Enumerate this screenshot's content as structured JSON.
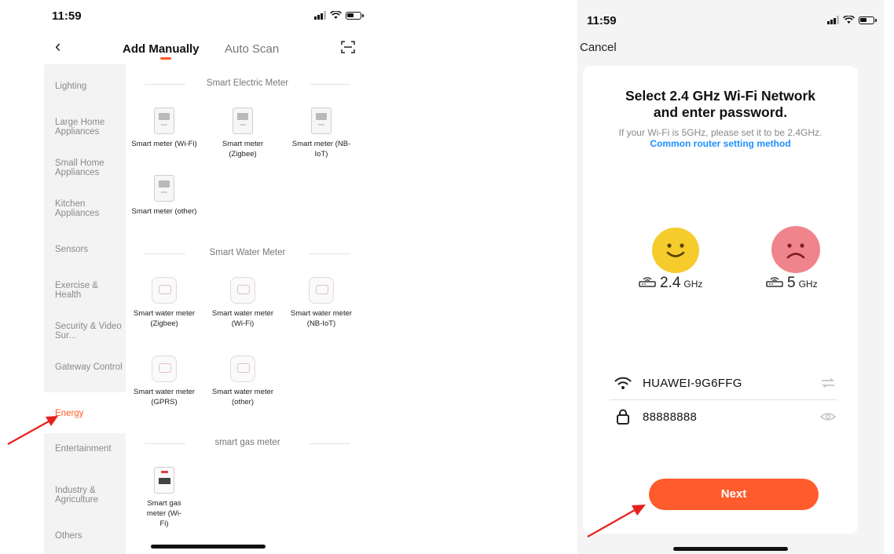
{
  "left_screen": {
    "status": {
      "time": "11:59"
    },
    "header": {
      "back_icon": "chevron-left-icon",
      "tab_manual": "Add Manually",
      "tab_auto": "Auto Scan",
      "scan_icon": "scan-icon",
      "accent": "#ff5a28"
    },
    "sidebar": {
      "items": [
        "Lighting",
        "Large Home Appliances",
        "Small Home Appliances",
        "Kitchen Appliances",
        "Sensors",
        "Exercise & Health",
        "Security & Video Sur...",
        "Gateway Control",
        "Energy",
        "Entertainment",
        "Industry & Agriculture",
        "Others"
      ],
      "active": "Energy"
    },
    "sections": [
      {
        "title": "Smart Electric Meter",
        "devices": [
          "Smart meter (Wi-Fi)",
          "Smart meter (Zigbee)",
          "Smart meter (NB-IoT)",
          "Smart meter (other)"
        ]
      },
      {
        "title": "Smart Water Meter",
        "devices": [
          "Smart water meter (Zigbee)",
          "Smart water meter (Wi-Fi)",
          "Smart water meter (NB-IoT)",
          "Smart water meter (GPRS)",
          "Smart water meter (other)"
        ]
      },
      {
        "title": "smart gas meter",
        "devices": [
          "Smart gas meter (Wi-Fi)"
        ]
      }
    ]
  },
  "right_screen": {
    "status": {
      "time": "11:59"
    },
    "cancel": "Cancel",
    "title_line1": "Select 2.4 GHz Wi-Fi Network",
    "title_line2": "and enter password.",
    "subtitle": "If your Wi-Fi is 5GHz, please set it to be 2.4GHz.",
    "link": "Common router setting method",
    "freq_good": {
      "value": "2.4",
      "unit": "GHz"
    },
    "freq_bad": {
      "value": "5",
      "unit": "GHz"
    },
    "wifi_name": "HUAWEI-9G6FFG",
    "password": "88888888",
    "next": "Next",
    "colors": {
      "button": "#ff5b2d",
      "link": "#1e90ff",
      "happy": "#f5cc2c",
      "sad": "#f0848d"
    }
  },
  "annotations": {
    "arrow_color": "#e8211c"
  }
}
